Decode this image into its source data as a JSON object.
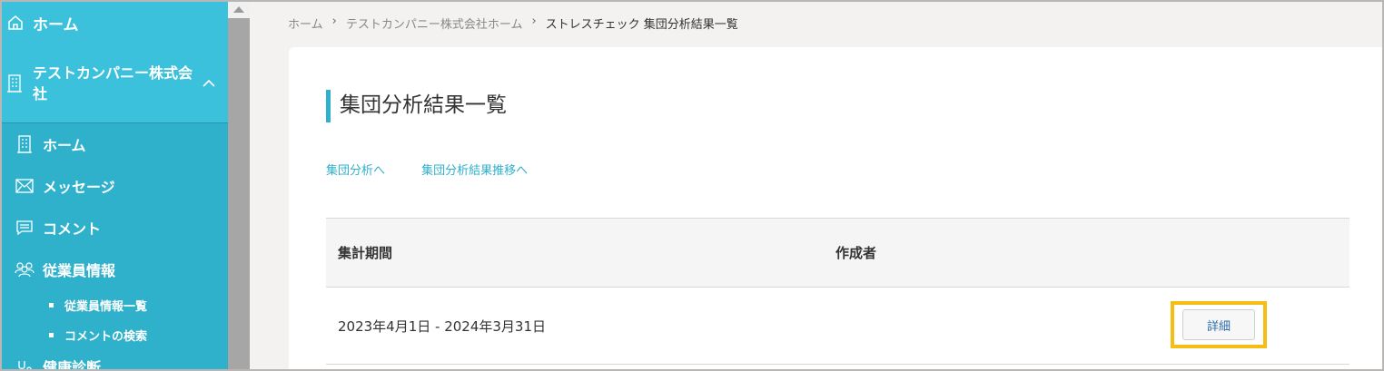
{
  "sidebar": {
    "home": "ホーム",
    "company": "テストカンパニー株式会社",
    "items": [
      {
        "label": "ホーム"
      },
      {
        "label": "メッセージ"
      },
      {
        "label": "コメント"
      },
      {
        "label": "従業員情報"
      }
    ],
    "sub_items": [
      {
        "label": "従業員情報一覧"
      },
      {
        "label": "コメントの検索"
      }
    ],
    "partial_item": "健康診断"
  },
  "breadcrumb": {
    "items": [
      "ホーム",
      "テストカンパニー株式会社ホーム"
    ],
    "separator": "›",
    "current": "ストレスチェック 集団分析結果一覧"
  },
  "main": {
    "title": "集団分析結果一覧",
    "links": [
      "集団分析へ",
      "集団分析結果推移へ"
    ],
    "table": {
      "headers": [
        "集計期間",
        "作成者"
      ],
      "rows": [
        {
          "period": "2023年4月1日 - 2024年3月31日",
          "author": "",
          "action": "詳細"
        }
      ]
    }
  },
  "colors": {
    "accent": "#2fb1cc",
    "highlight": "#f6bd16"
  }
}
